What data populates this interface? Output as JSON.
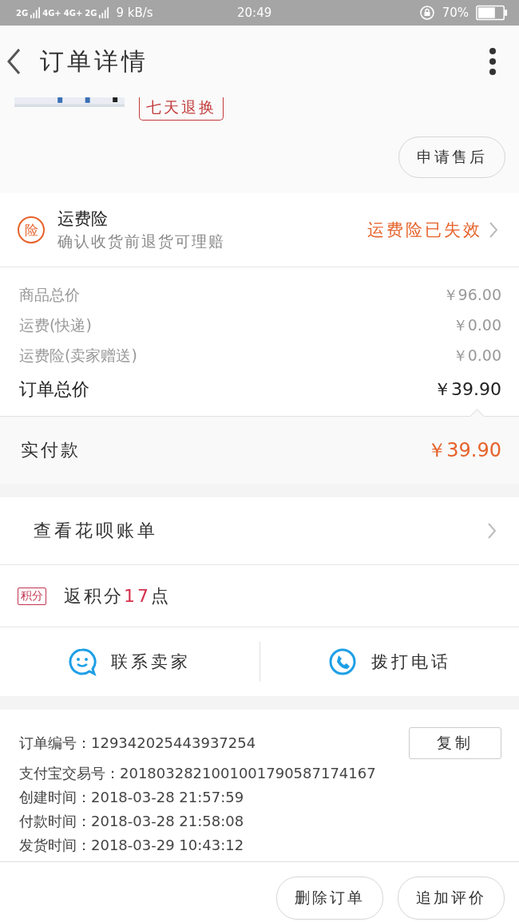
{
  "status_bar": {
    "network_labels": [
      "2G",
      "4G+",
      "4G+",
      "2G"
    ],
    "speed": "9 kB/s",
    "time": "20:49",
    "battery_text": "70%"
  },
  "header": {
    "title": "订单详情"
  },
  "product": {
    "tag": "七天退换",
    "after_sale_button": "申请售后"
  },
  "insurance": {
    "badge": "险",
    "title": "运费险",
    "subtitle": "确认收货前退货可理赔",
    "status": "运费险已失效"
  },
  "prices": [
    {
      "label": "商品总价",
      "value": "￥96.00",
      "kind": "minor"
    },
    {
      "label": "运费(快递)",
      "value": "￥0.00",
      "kind": "minor"
    },
    {
      "label": "运费险(卖家赠送)",
      "value": "￥0.00",
      "kind": "minor"
    },
    {
      "label": "订单总价",
      "value": "￥39.90",
      "kind": "total"
    }
  ],
  "paid": {
    "label": "实付款",
    "value": "￥39.90"
  },
  "huabei": {
    "label": "查看花呗账单"
  },
  "points": {
    "badge": "积分",
    "before": "返积分",
    "count": "17",
    "after": "点"
  },
  "contact": [
    {
      "label": "联系卖家",
      "kind": "chat"
    },
    {
      "label": "拨打电话",
      "kind": "phone"
    }
  ],
  "info": {
    "copy_button": "复制",
    "lines": [
      {
        "label": "订单编号：",
        "value": "129342025443937254"
      },
      {
        "label": "支付宝交易号：",
        "value": "2018032821001001790587174167"
      },
      {
        "label": "创建时间：",
        "value": "2018-03-28 21:57:59"
      },
      {
        "label": "付款时间：",
        "value": "2018-03-28 21:58:08"
      },
      {
        "label": "发货时间：",
        "value": "2018-03-29 10:43:12"
      }
    ]
  },
  "bottom_buttons": [
    "删除订单",
    "追加评价"
  ]
}
